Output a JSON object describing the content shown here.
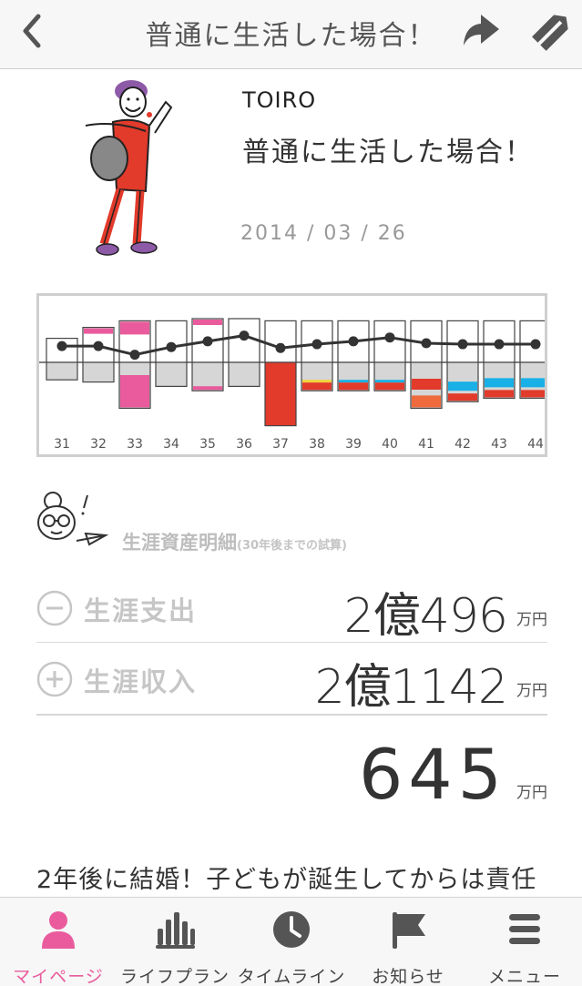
{
  "navbar": {
    "title": "普通に生活した場合！"
  },
  "header": {
    "brand": "TOIRO",
    "plan_title": "普通に生活した場合！",
    "date": "2014 / 03 / 26"
  },
  "colors": {
    "accent_pink": "#e95b9c",
    "expense_red": "#e23a2b",
    "cyan": "#18b0e6",
    "orange": "#ef6a3c",
    "yellow": "#f3d438",
    "gray_bar": "#d6d6d6"
  },
  "chart_data": {
    "type": "bar",
    "categories": [
      "31",
      "32",
      "33",
      "34",
      "35",
      "36",
      "37",
      "38",
      "39",
      "40",
      "41",
      "42",
      "43",
      "44"
    ],
    "series": [
      {
        "values": [
          0.55,
          0.8,
          0.95,
          0.95,
          1.0,
          1.0,
          0.95,
          0.95,
          0.95,
          0.95,
          0.95,
          0.95,
          0.95,
          0.95
        ]
      },
      {
        "values": [
          -0.4,
          -0.45,
          -1.05,
          -0.55,
          -0.65,
          -0.55,
          -1.45,
          -0.65,
          -0.65,
          -0.65,
          -1.05,
          -0.9,
          -0.82,
          -0.82
        ]
      },
      {
        "values": [
          0.85,
          0.85,
          0.4,
          0.8,
          1.1,
          1.4,
          0.75,
          0.95,
          1.1,
          1.3,
          1.0,
          0.95,
          0.95,
          0.95
        ]
      }
    ]
  },
  "detail": {
    "heading": "生涯資産明細",
    "heading_note": "(30年後までの試算)",
    "expense": {
      "label": "生涯支出",
      "value": "2億496",
      "unit": "万円"
    },
    "income": {
      "label": "生涯収入",
      "value": "2億1142",
      "unit": "万円"
    },
    "balance": {
      "value": "645",
      "unit": "万円"
    }
  },
  "description": "2年後に結婚！子どもが誕生してからは責任",
  "tabs": [
    {
      "label": "マイページ",
      "icon": "person-icon",
      "active": true
    },
    {
      "label": "ライフプラン",
      "icon": "bar-chart-icon",
      "active": false
    },
    {
      "label": "タイムライン",
      "icon": "clock-icon",
      "active": false
    },
    {
      "label": "お知らせ",
      "icon": "flag-icon",
      "active": false
    },
    {
      "label": "メニュー",
      "icon": "menu-icon",
      "active": false
    }
  ]
}
